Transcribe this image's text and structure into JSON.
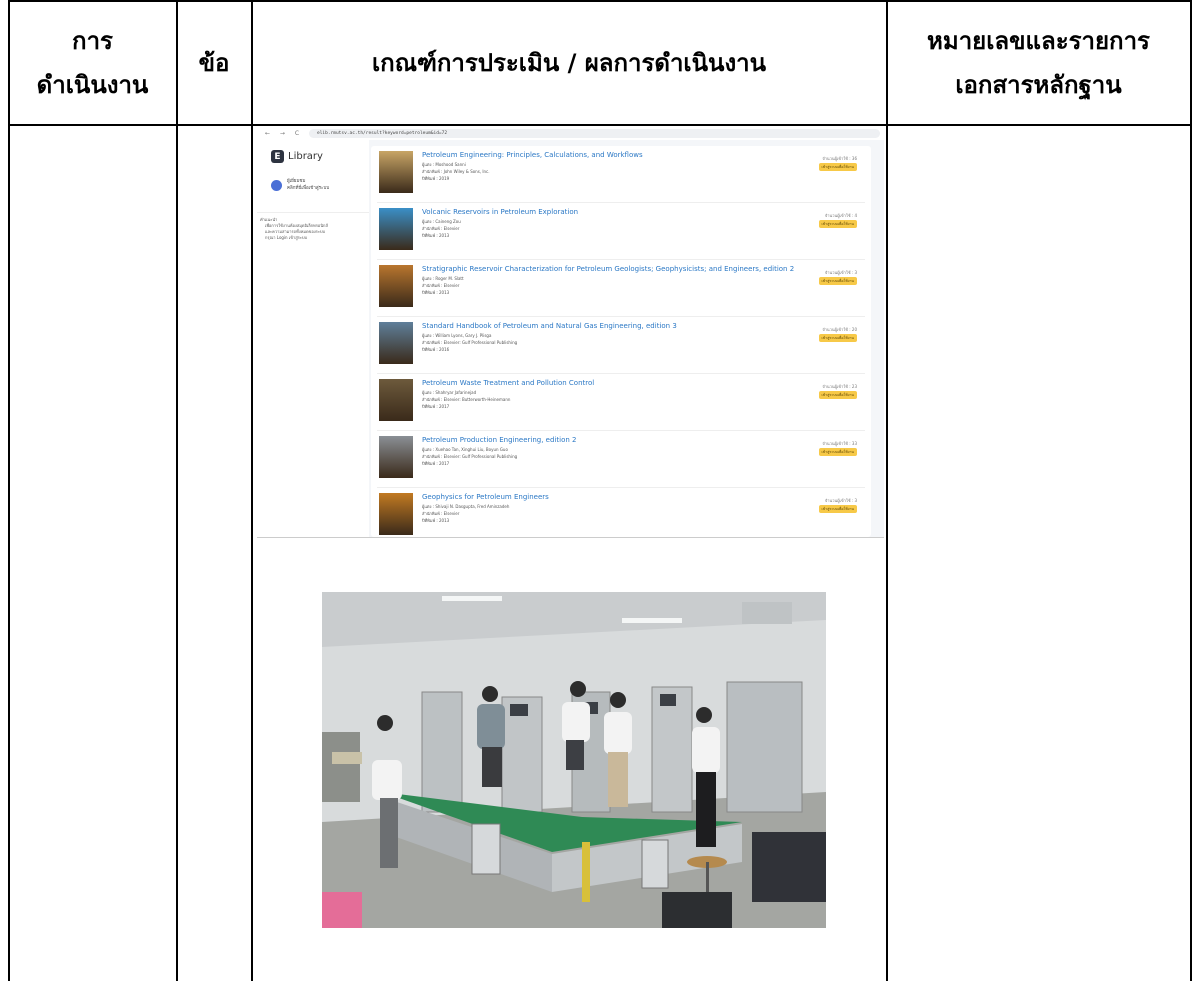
{
  "header": {
    "col1_line1": "การ",
    "col1_line2": "ดำเนินงาน",
    "col2": "ข้อ",
    "col3": "เกณฑ์การประเมิน / ผลการดำเนินงาน",
    "col4_line1": "หมายเลขและรายการ",
    "col4_line2": "เอกสารหลักฐาน"
  },
  "screenshot": {
    "browser": {
      "nav": "← → C",
      "url": "elib.rmutsv.ac.th/result?keyword=petroleum&id=72"
    },
    "app_name": "Library",
    "user_name": "ผู้เยี่ยมชม",
    "user_subtitle": "คลิกที่นี่เพื่อเข้าสู่ระบบ",
    "note": {
      "title": "คำแนะนำ",
      "line1": "เพื่อการใช้งานห้องสมุดอิเล็กทรอนิกส์",
      "line2": "และความสามารถทั้งหมดของระบบ",
      "line3": "กรุณา Login เข้าสู่ระบบ"
    },
    "results": [
      {
        "title": "Petroleum Engineering: Principles, Calculations, and Workflows",
        "author": "ผู้แต่ง : Moshood Sanni",
        "publisher": "สำนักพิมพ์ : John Wiley & Sons, Inc.",
        "year": "ปีที่พิมพ์ : 2019",
        "avail": "จำนวนผู้เข้าใช้ : 36",
        "badge": "เข้าสู่ระบบเพื่อใช้งาน",
        "cover_color": "#c8a566"
      },
      {
        "title": "Volcanic Reservoirs in Petroleum Exploration",
        "author": "ผู้แต่ง : Caineng Zou",
        "publisher": "สำนักพิมพ์ : Elsevier",
        "year": "ปีที่พิมพ์ : 2013",
        "avail": "จำนวนผู้เข้าใช้ : 4",
        "badge": "เข้าสู่ระบบเพื่อใช้งาน",
        "cover_color": "#3a8fc7"
      },
      {
        "title": "Stratigraphic Reservoir Characterization for Petroleum Geologists; Geophysicists; and Engineers, edition 2",
        "author": "ผู้แต่ง : Roger M. Slatt",
        "publisher": "สำนักพิมพ์ : Elsevier",
        "year": "ปีที่พิมพ์ : 2013",
        "avail": "จำนวนผู้เข้าใช้ : 3",
        "badge": "เข้าสู่ระบบเพื่อใช้งาน",
        "cover_color": "#b9762e"
      },
      {
        "title": "Standard Handbook of Petroleum and Natural Gas Engineering, edition 3",
        "author": "ผู้แต่ง : William Lyons, Gary J. Plisga",
        "publisher": "สำนักพิมพ์ : Elsevier: Gulf Professional Publishing",
        "year": "ปีที่พิมพ์ : 2016",
        "avail": "จำนวนผู้เข้าใช้ : 20",
        "badge": "เข้าสู่ระบบเพื่อใช้งาน",
        "cover_color": "#5f7f9a"
      },
      {
        "title": "Petroleum Waste Treatment and Pollution Control",
        "author": "ผู้แต่ง : Shahryar Jafarinejad",
        "publisher": "สำนักพิมพ์ : Elsevier: Butterworth-Heinemann",
        "year": "ปีที่พิมพ์ : 2017",
        "avail": "จำนวนผู้เข้าใช้ : 23",
        "badge": "เข้าสู่ระบบเพื่อใช้งาน",
        "cover_color": "#6d5a3c"
      },
      {
        "title": "Petroleum Production Engineering, edition 2",
        "author": "ผู้แต่ง : Xuehao Tan, Xinghui Liu, Boyun Guo",
        "publisher": "สำนักพิมพ์ : Elsevier: Gulf Professional Publishing",
        "year": "ปีที่พิมพ์ : 2017",
        "avail": "จำนวนผู้เข้าใช้ : 33",
        "badge": "เข้าสู่ระบบเพื่อใช้งาน",
        "cover_color": "#8a8f95"
      },
      {
        "title": "Geophysics for Petroleum Engineers",
        "author": "ผู้แต่ง : Shivaji N. Dasgupta, Fred Aminzadeh",
        "publisher": "สำนักพิมพ์ : Elsevier",
        "year": "ปีที่พิมพ์ : 2013",
        "avail": "จำนวนผู้เข้าใช้ : 3",
        "badge": "เข้าสู่ระบบเพื่อใช้งาน",
        "cover_color": "#c27a22"
      }
    ]
  },
  "photo": {
    "colors": {
      "wall": "#d9dcde",
      "floor": "#9a9c98",
      "conveyor": "#2f8a55",
      "machine": "#b7bcbf"
    }
  }
}
